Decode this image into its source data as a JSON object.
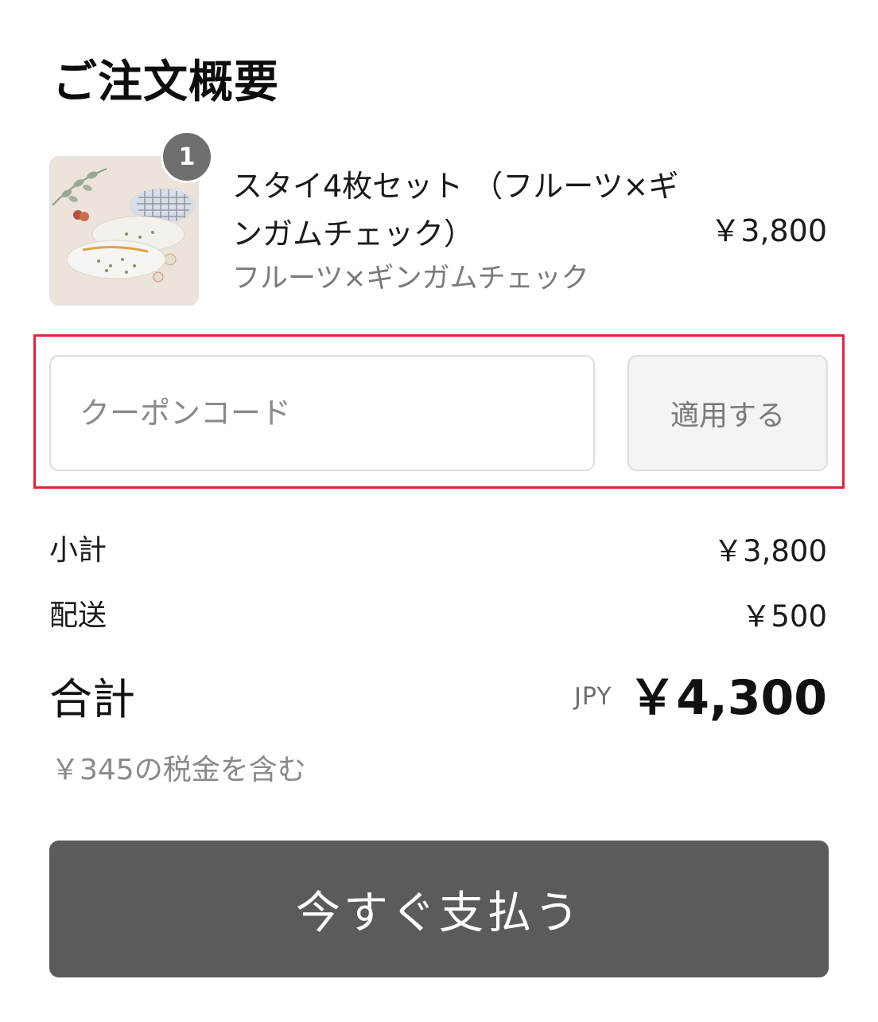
{
  "summary": {
    "title": "ご注文概要"
  },
  "item": {
    "quantity_badge": "1",
    "name": "スタイ4枚セット （フルーツ×ギンガムチェック）",
    "variant": "フルーツ×ギンガムチェック",
    "price": "￥3,800",
    "image_icon": "baby-bibs-product-photo"
  },
  "coupon": {
    "placeholder": "クーポンコード",
    "value": "",
    "apply_label": "適用する",
    "highlight_color": "#e0223b"
  },
  "totals": {
    "subtotal_label": "小計",
    "subtotal_value": "￥3,800",
    "shipping_label": "配送",
    "shipping_value": "￥500",
    "total_label": "合計",
    "currency": "JPY",
    "total_value": "￥4,300",
    "tax_note": "￥345の税金を含む"
  },
  "checkout": {
    "pay_label": "今すぐ支払う",
    "button_color": "#5b5b5b"
  }
}
